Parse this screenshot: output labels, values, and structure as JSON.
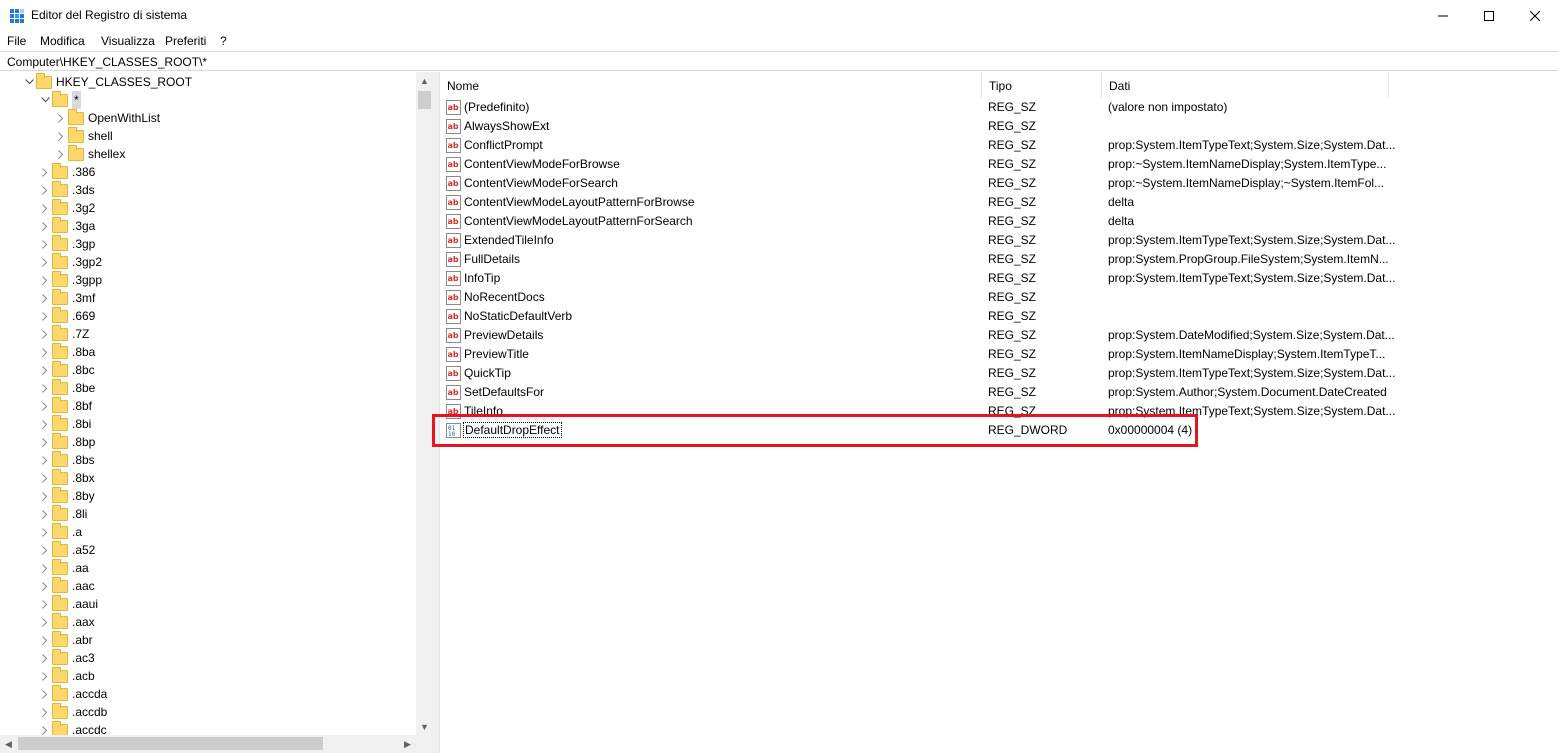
{
  "window": {
    "title": "Editor del Registro di sistema",
    "controls": {
      "minimize": "—",
      "maximize": "☐",
      "close": "✕"
    }
  },
  "menu": [
    "File",
    "Modifica",
    "Visualizza",
    "Preferiti",
    "?"
  ],
  "address": "Computer\\HKEY_CLASSES_ROOT\\*",
  "tree": [
    {
      "label": "HKEY_CLASSES_ROOT",
      "level": 0,
      "expanded": true
    },
    {
      "label": "*",
      "level": 1,
      "expanded": true,
      "selected": true
    },
    {
      "label": "OpenWithList",
      "level": 2
    },
    {
      "label": "shell",
      "level": 2
    },
    {
      "label": "shellex",
      "level": 2
    },
    {
      "label": ".386",
      "level": 1
    },
    {
      "label": ".3ds",
      "level": 1
    },
    {
      "label": ".3g2",
      "level": 1
    },
    {
      "label": ".3ga",
      "level": 1
    },
    {
      "label": ".3gp",
      "level": 1
    },
    {
      "label": ".3gp2",
      "level": 1
    },
    {
      "label": ".3gpp",
      "level": 1
    },
    {
      "label": ".3mf",
      "level": 1
    },
    {
      "label": ".669",
      "level": 1
    },
    {
      "label": ".7Z",
      "level": 1
    },
    {
      "label": ".8ba",
      "level": 1
    },
    {
      "label": ".8bc",
      "level": 1
    },
    {
      "label": ".8be",
      "level": 1
    },
    {
      "label": ".8bf",
      "level": 1
    },
    {
      "label": ".8bi",
      "level": 1
    },
    {
      "label": ".8bp",
      "level": 1
    },
    {
      "label": ".8bs",
      "level": 1
    },
    {
      "label": ".8bx",
      "level": 1
    },
    {
      "label": ".8by",
      "level": 1
    },
    {
      "label": ".8li",
      "level": 1
    },
    {
      "label": ".a",
      "level": 1
    },
    {
      "label": ".a52",
      "level": 1
    },
    {
      "label": ".aa",
      "level": 1
    },
    {
      "label": ".aac",
      "level": 1
    },
    {
      "label": ".aaui",
      "level": 1
    },
    {
      "label": ".aax",
      "level": 1
    },
    {
      "label": ".abr",
      "level": 1
    },
    {
      "label": ".ac3",
      "level": 1
    },
    {
      "label": ".acb",
      "level": 1
    },
    {
      "label": ".accda",
      "level": 1
    },
    {
      "label": ".accdb",
      "level": 1
    },
    {
      "label": ".accdc",
      "level": 1
    }
  ],
  "columns": {
    "name": "Nome",
    "type": "Tipo",
    "data": "Dati"
  },
  "values": [
    {
      "name": "(Predefinito)",
      "type": "REG_SZ",
      "data": "(valore non impostato)",
      "icon": "string"
    },
    {
      "name": "AlwaysShowExt",
      "type": "REG_SZ",
      "data": "",
      "icon": "string"
    },
    {
      "name": "ConflictPrompt",
      "type": "REG_SZ",
      "data": "prop:System.ItemTypeText;System.Size;System.Dat...",
      "icon": "string"
    },
    {
      "name": "ContentViewModeForBrowse",
      "type": "REG_SZ",
      "data": "prop:~System.ItemNameDisplay;System.ItemType...",
      "icon": "string"
    },
    {
      "name": "ContentViewModeForSearch",
      "type": "REG_SZ",
      "data": "prop:~System.ItemNameDisplay;~System.ItemFol...",
      "icon": "string"
    },
    {
      "name": "ContentViewModeLayoutPatternForBrowse",
      "type": "REG_SZ",
      "data": "delta",
      "icon": "string"
    },
    {
      "name": "ContentViewModeLayoutPatternForSearch",
      "type": "REG_SZ",
      "data": "delta",
      "icon": "string"
    },
    {
      "name": "ExtendedTileInfo",
      "type": "REG_SZ",
      "data": "prop:System.ItemTypeText;System.Size;System.Dat...",
      "icon": "string"
    },
    {
      "name": "FullDetails",
      "type": "REG_SZ",
      "data": "prop:System.PropGroup.FileSystem;System.ItemN...",
      "icon": "string"
    },
    {
      "name": "InfoTip",
      "type": "REG_SZ",
      "data": "prop:System.ItemTypeText;System.Size;System.Dat...",
      "icon": "string"
    },
    {
      "name": "NoRecentDocs",
      "type": "REG_SZ",
      "data": "",
      "icon": "string"
    },
    {
      "name": "NoStaticDefaultVerb",
      "type": "REG_SZ",
      "data": "",
      "icon": "string"
    },
    {
      "name": "PreviewDetails",
      "type": "REG_SZ",
      "data": "prop:System.DateModified;System.Size;System.Dat...",
      "icon": "string"
    },
    {
      "name": "PreviewTitle",
      "type": "REG_SZ",
      "data": "prop:System.ItemNameDisplay;System.ItemTypeT...",
      "icon": "string"
    },
    {
      "name": "QuickTip",
      "type": "REG_SZ",
      "data": "prop:System.ItemTypeText;System.Size;System.Dat...",
      "icon": "string"
    },
    {
      "name": "SetDefaultsFor",
      "type": "REG_SZ",
      "data": "prop:System.Author;System.Document.DateCreated",
      "icon": "string"
    },
    {
      "name": "TileInfo",
      "type": "REG_SZ",
      "data": "prop:System.ItemTypeText;System.Size;System.Dat...",
      "icon": "string"
    },
    {
      "name": "DefaultDropEffect",
      "type": "REG_DWORD",
      "data": "0x00000004 (4)",
      "icon": "dword",
      "focused": true
    }
  ],
  "colors": {
    "highlight_border": "#e5141f",
    "folder": "#fcd86c",
    "string_icon": "#d0312d",
    "dword_icon": "#2a55b8"
  }
}
